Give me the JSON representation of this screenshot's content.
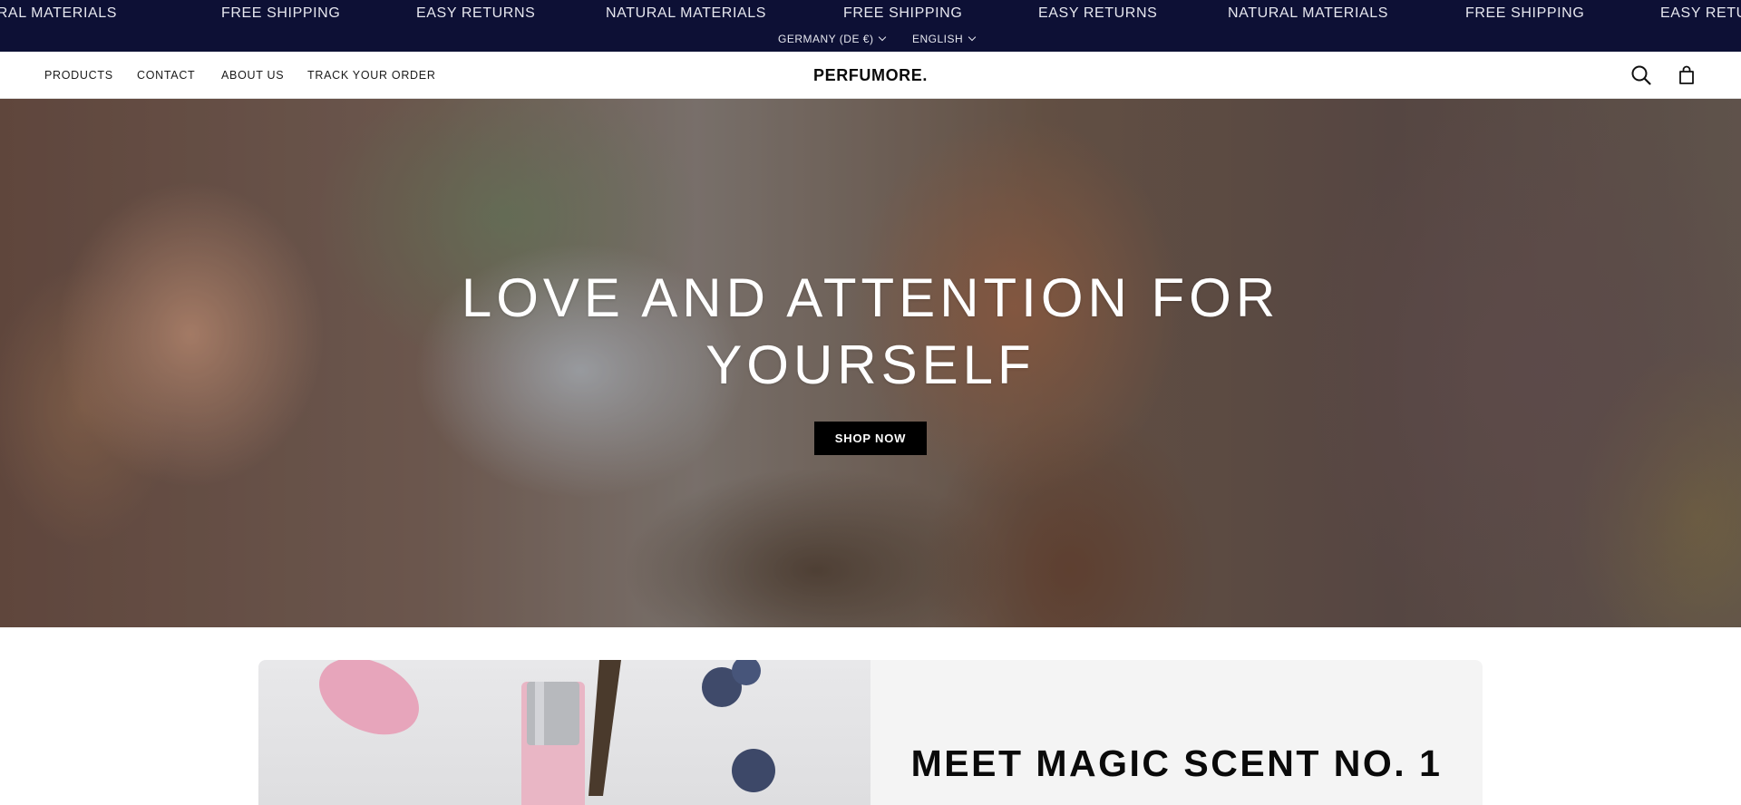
{
  "announcement": {
    "marquee": [
      "NATURAL MATERIALS",
      "FREE SHIPPING",
      "EASY RETURNS",
      "NATURAL MATERIALS",
      "FREE SHIPPING",
      "EASY RETURNS",
      "NATURAL MATERIALS",
      "FREE SHIPPING",
      "EASY RETURNS"
    ],
    "country_selector": "GERMANY (DE €)",
    "language_selector": "ENGLISH"
  },
  "header": {
    "nav": [
      "PRODUCTS",
      "CONTACT",
      "ABOUT US",
      "TRACK YOUR ORDER"
    ],
    "brand": "PERFUMORE.",
    "icons": [
      "search-icon",
      "cart-icon"
    ]
  },
  "hero": {
    "title_line1": "LOVE AND ATTENTION FOR",
    "title_line2": "YOURSELF",
    "cta": "SHOP NOW"
  },
  "feature": {
    "title": "MEET MAGIC SCENT NO. 1"
  },
  "colors": {
    "announcement_bg": "#0d1035",
    "button_bg": "#000000",
    "panel_bg": "#f4f4f4"
  }
}
